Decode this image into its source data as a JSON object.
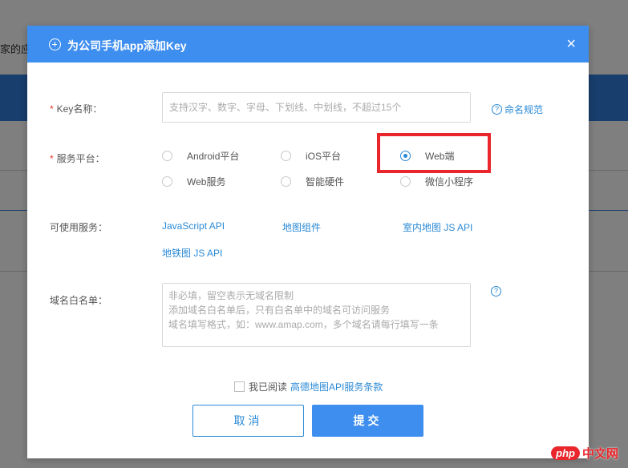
{
  "background": {
    "partial_text": "家的应"
  },
  "dialog": {
    "title": "为公司手机app添加Key",
    "close_label": "×",
    "key_name": {
      "label": "Key名称：",
      "placeholder": "支持汉字、数字、字母、下划线、中划线，不超过15个",
      "value": "",
      "help_link": "命名规范"
    },
    "platform": {
      "label": "服务平台：",
      "options": [
        {
          "label": "Android平台",
          "checked": false
        },
        {
          "label": "iOS平台",
          "checked": false
        },
        {
          "label": "Web端",
          "checked": true
        },
        {
          "label": "Web服务",
          "checked": false
        },
        {
          "label": "智能硬件",
          "checked": false
        },
        {
          "label": "微信小程序",
          "checked": false
        }
      ]
    },
    "services": {
      "label": "可使用服务：",
      "items": [
        "JavaScript API",
        "地图组件",
        "室内地图 JS API",
        "地铁图 JS API"
      ]
    },
    "whitelist": {
      "label": "域名白名单：",
      "placeholder": "非必填，留空表示无域名限制\n添加域名白名单后，只有白名单中的域名可访问服务\n域名填写格式，如：www.amap.com，多个域名请每行填写一条"
    },
    "agreement": {
      "text": "我已阅读",
      "link": "高德地图API服务条款",
      "checked": false
    },
    "buttons": {
      "cancel": "取消",
      "submit": "提交"
    },
    "required_mark": "*",
    "help_glyph": "?"
  },
  "watermark": {
    "logo": "php",
    "text": "中文网"
  },
  "colors": {
    "header": "#3e8ef0",
    "link": "#2b8ad6",
    "highlight": "#e8262b",
    "required": "#e33333"
  }
}
